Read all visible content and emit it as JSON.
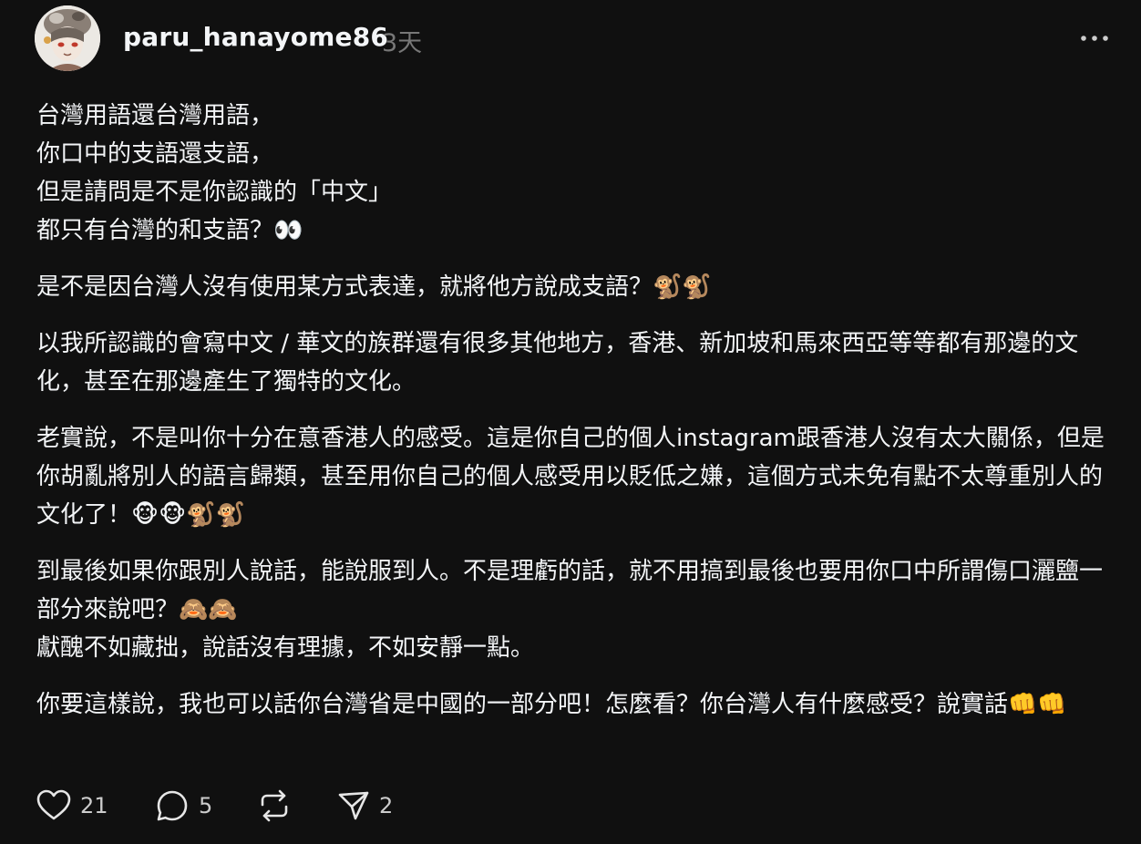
{
  "post": {
    "username": "paru_hanayome86",
    "timestamp": "3天",
    "paragraphs": [
      "台灣用語還台灣用語，\n你口中的支語還支語，\n但是請問是不是你認識的「中文」\n都只有台灣的和支語？👀",
      "是不是因台灣人沒有使用某方式表達，就將他方說成支語？🐒🐒",
      "以我所認識的會寫中文 / 華文的族群還有很多其他地方，香港、新加坡和馬來西亞等等都有那邊的文化，甚至在那邊產生了獨特的文化。",
      "老實說，不是叫你十分在意香港人的感受。這是你自己的個人instagram跟香港人沒有太大關係，但是你胡亂將別人的語言歸類，甚至用你自己的個人感受用以貶低之嫌，這個方式未免有點不太尊重別人的文化了！🐵🐵🐒🐒",
      "到最後如果你跟別人說話，能說服到人。不是理虧的話，就不用搞到最後也要用你口中所謂傷口灑鹽一部分來說吧？🙈🙈\n獻醜不如藏拙，說話沒有理據，不如安靜一點。",
      "你要這樣說，我也可以話你台灣省是中國的一部分吧！怎麼看？你台灣人有什麼感受？說實話👊👊"
    ]
  },
  "actions": {
    "like_count": "21",
    "reply_count": "5",
    "repost_count": "",
    "share_count": "2"
  },
  "icons": {
    "like": "heart-icon",
    "reply": "comment-bubble-icon",
    "repost": "repost-icon",
    "share": "send-icon",
    "more": "more-dots-icon"
  },
  "colors": {
    "background": "#101010",
    "text": "#f3f5f7",
    "muted": "#777777"
  }
}
